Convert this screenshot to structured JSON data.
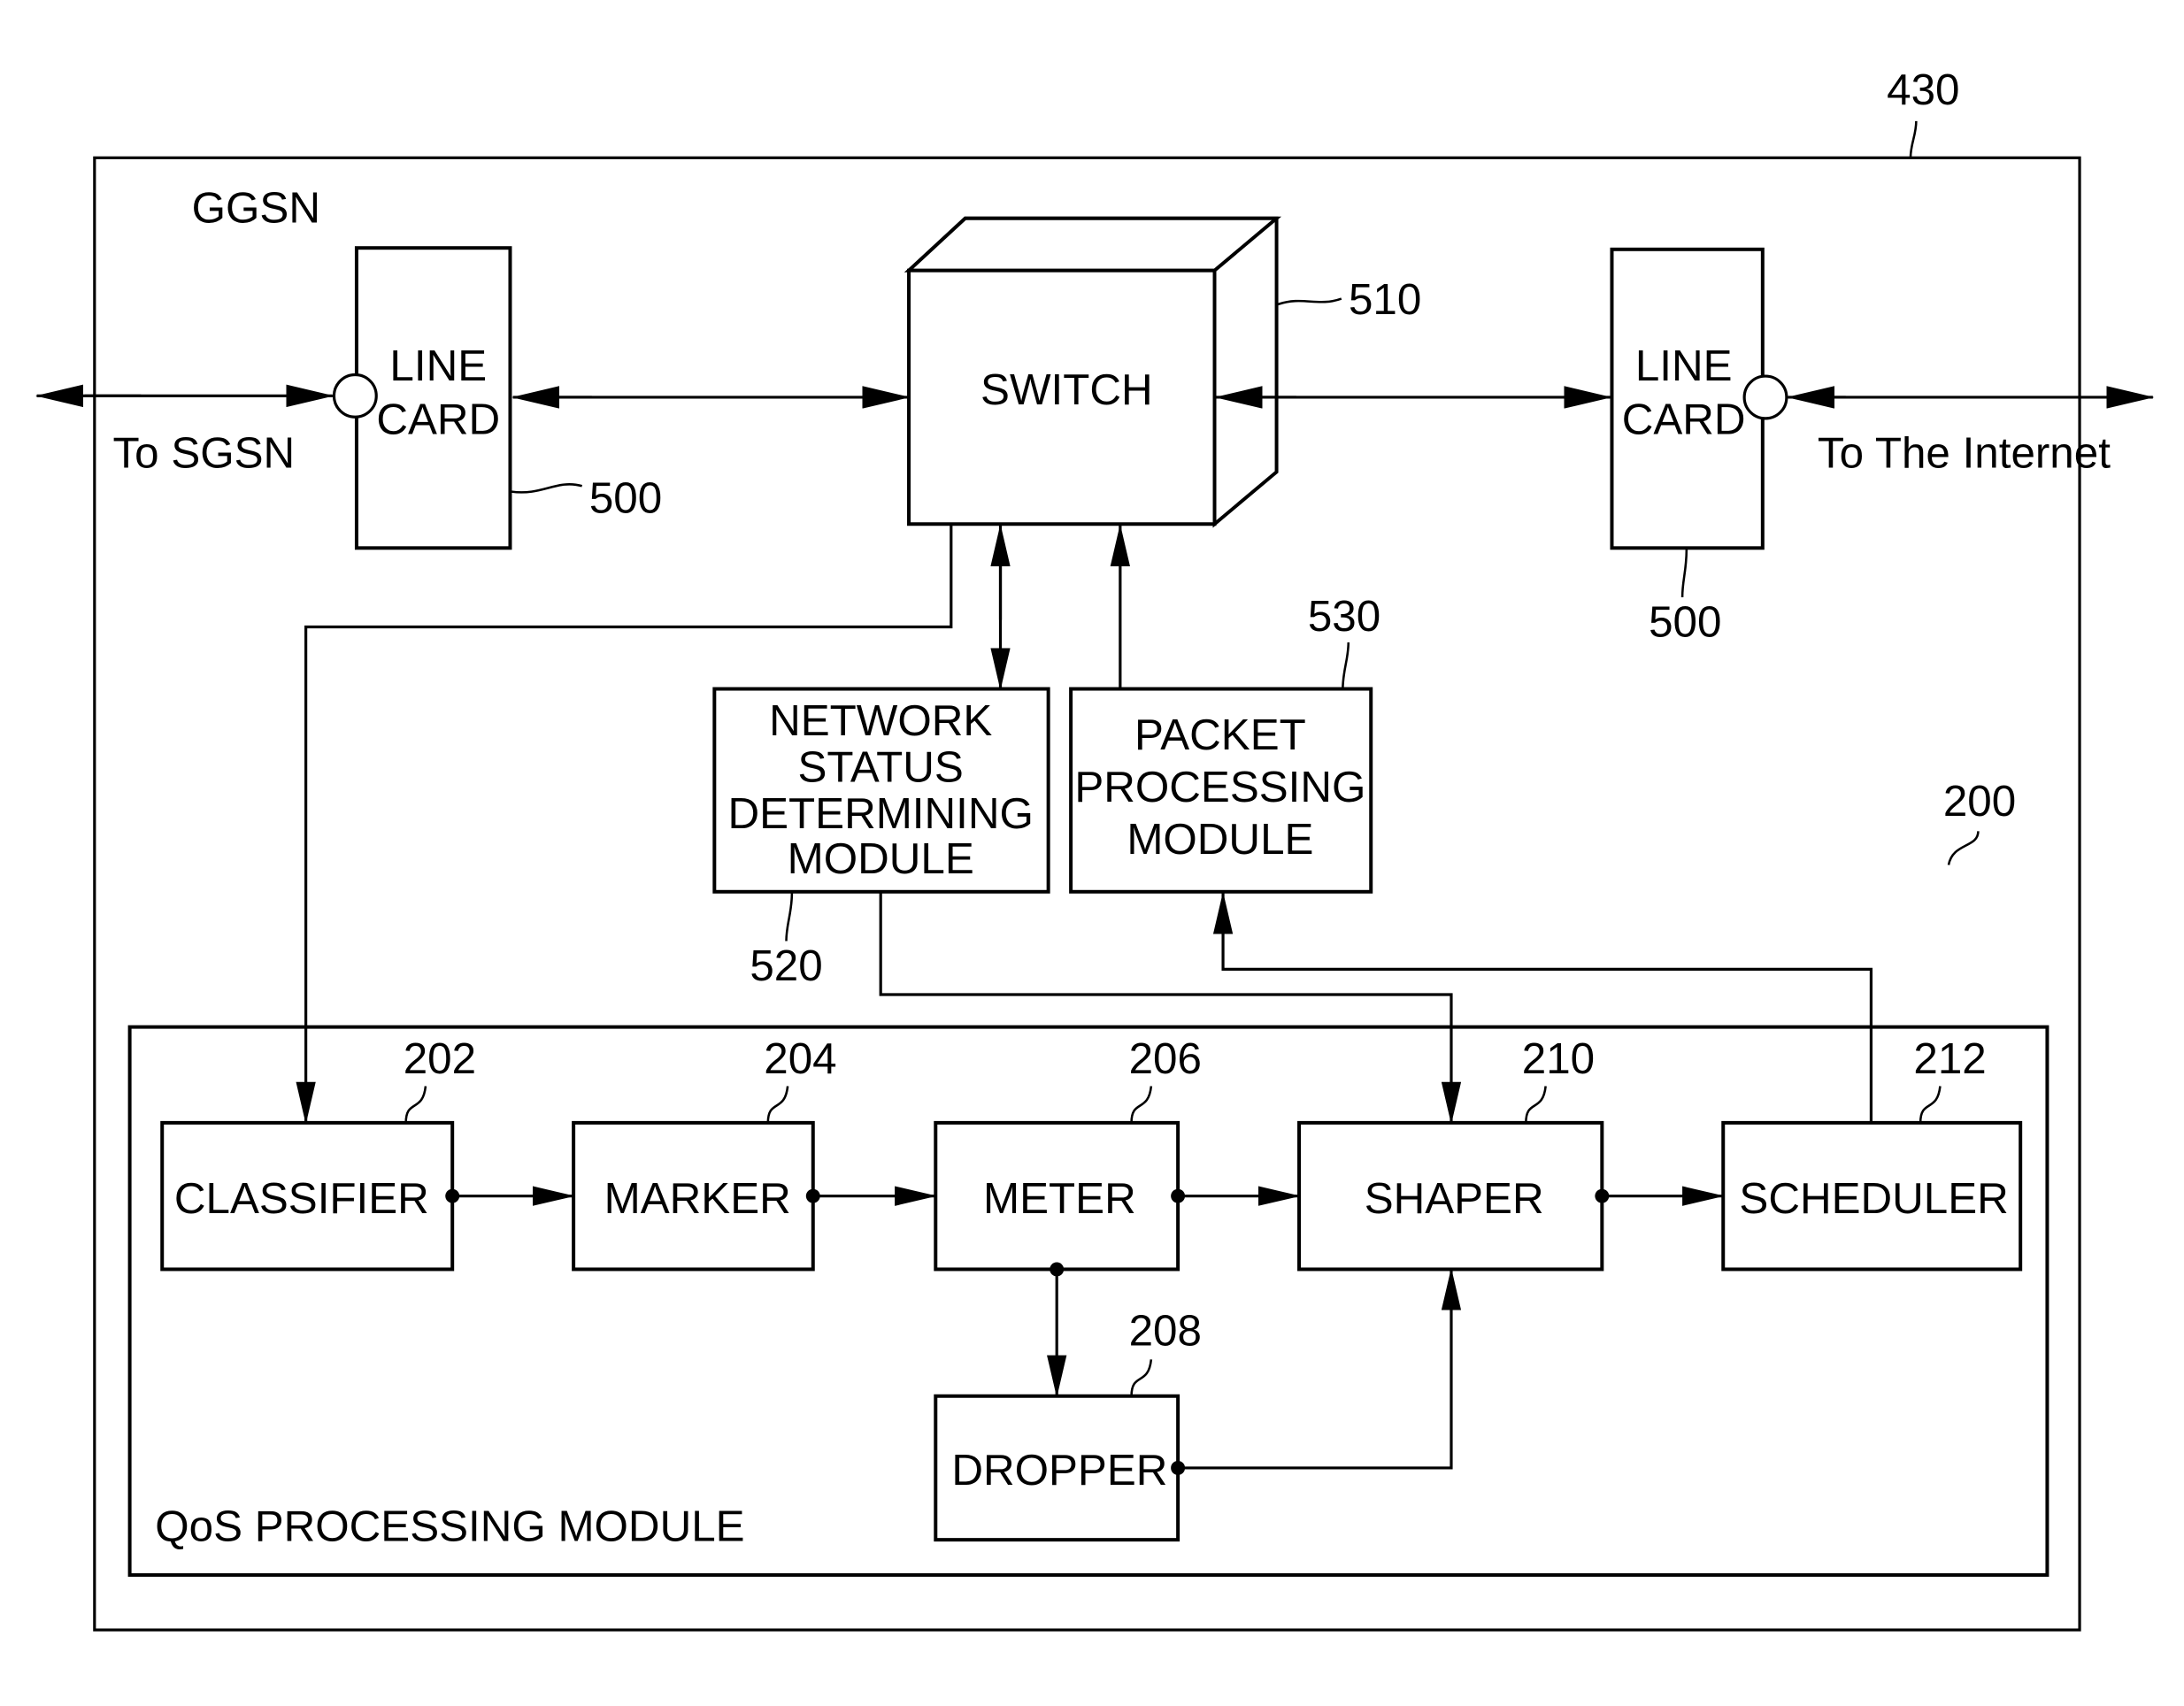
{
  "figure": {
    "outer_block": {
      "label": "GGSN",
      "ref": "430"
    },
    "qos_module": {
      "label": "QoS PROCESSING MODULE",
      "ref": "200"
    },
    "external": {
      "left": "To SGSN",
      "right": "To The Internet"
    },
    "line_card_left": {
      "lines": [
        "LINE",
        "CARD"
      ],
      "ref": "500"
    },
    "line_card_right": {
      "lines": [
        "LINE",
        "CARD"
      ],
      "ref": "500"
    },
    "switch": {
      "label": "SWITCH",
      "ref": "510"
    },
    "network_status": {
      "lines": [
        "NETWORK",
        "STATUS",
        "DETERMINING",
        "MODULE"
      ],
      "ref": "520"
    },
    "packet_processing": {
      "lines": [
        "PACKET",
        "PROCESSING",
        "MODULE"
      ],
      "ref": "530"
    },
    "classifier": {
      "label": "CLASSIFIER",
      "ref": "202"
    },
    "marker": {
      "label": "MARKER",
      "ref": "204"
    },
    "meter": {
      "label": "METER",
      "ref": "206"
    },
    "dropper": {
      "label": "DROPPER",
      "ref": "208"
    },
    "shaper": {
      "label": "SHAPER",
      "ref": "210"
    },
    "scheduler": {
      "label": "SCHEDULER",
      "ref": "212"
    }
  }
}
